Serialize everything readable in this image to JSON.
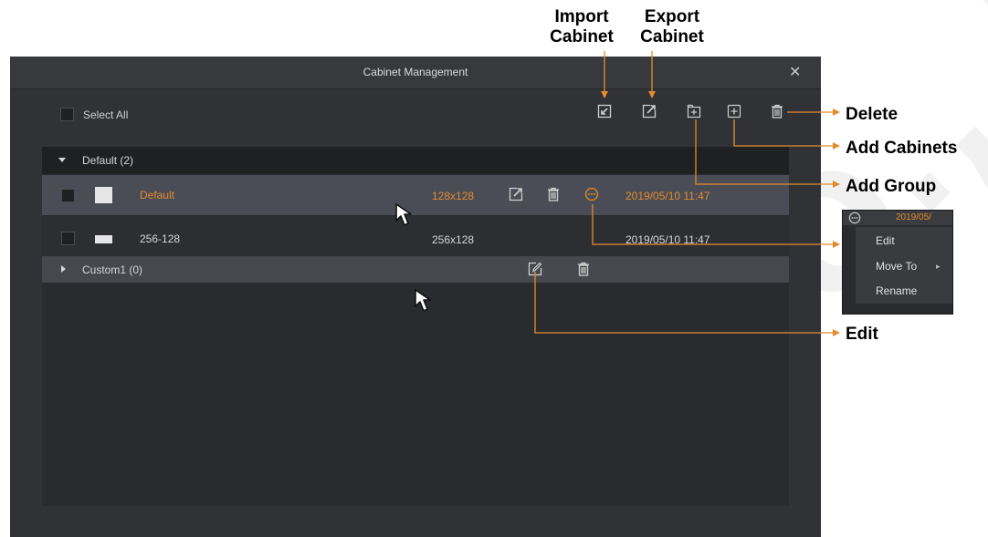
{
  "watermark": "CO., LTD",
  "dialog": {
    "title": "Cabinet Management",
    "close_glyph": "✕",
    "select_all_label": "Select All",
    "toolbar_icons": [
      "import-icon",
      "export-icon",
      "add-group-icon",
      "add-cabinet-icon",
      "trash-icon"
    ]
  },
  "groups": [
    {
      "name": "Default (2)",
      "expanded": true,
      "cabinets": [
        {
          "name": "Default",
          "size": "128x128",
          "date": "2019/05/10 11:47",
          "selected": true
        },
        {
          "name": "256-128",
          "size": "256x128",
          "date": "2019/05/10 11:47",
          "selected": false
        }
      ]
    },
    {
      "name": "Custom1 (0)",
      "expanded": false
    }
  ],
  "context_menu": {
    "header_date": "2019/05/",
    "items": [
      "Edit",
      "Move To",
      "Rename"
    ]
  },
  "annotations": {
    "import_line1": "Import",
    "import_line2": "Cabinet",
    "export_line1": "Export",
    "export_line2": "Cabinet",
    "delete": "Delete",
    "add_cabinets": "Add Cabinets",
    "add_group": "Add Group",
    "edit": "Edit"
  },
  "colors": {
    "accent": "#e48b2f",
    "dialog_bg": "#313236",
    "selected_row": "#4a4d55"
  }
}
